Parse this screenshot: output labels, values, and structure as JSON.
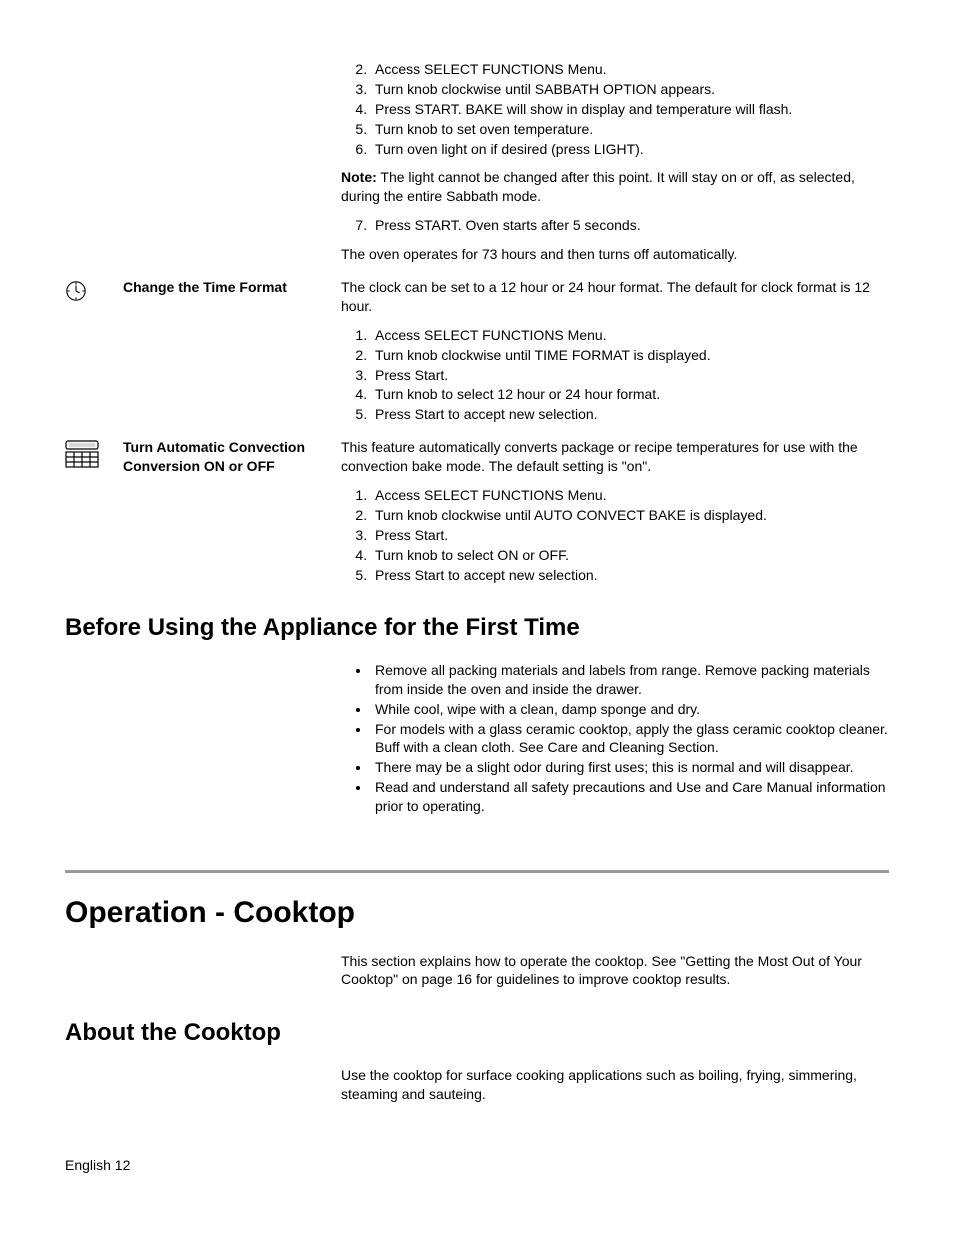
{
  "block1": {
    "step2": "Access SELECT FUNCTIONS Menu.",
    "step3": "Turn knob clockwise until SABBATH OPTION appears.",
    "step4": "Press START. BAKE will show in display and temperature will flash.",
    "step5": "Turn knob to set oven temperature.",
    "step6": "Turn oven light on if desired (press LIGHT).",
    "note_label": "Note:",
    "note_text": " The light cannot be changed after this point. It will stay on or off, as selected, during the entire Sabbath mode.",
    "step7": "Press START. Oven starts after 5 seconds.",
    "after": "The oven operates for 73 hours and then turns off automatically."
  },
  "block2": {
    "label": "Change the Time Format",
    "intro": "The clock can be set to a 12 hour or 24 hour format. The default for clock format is 12 hour.",
    "step1": "Access SELECT FUNCTIONS Menu.",
    "step2": "Turn knob clockwise until TIME FORMAT is displayed.",
    "step3": "Press Start.",
    "step4": "Turn knob to select 12 hour or 24 hour format.",
    "step5": "Press Start to accept new selection."
  },
  "block3": {
    "label": "Turn Automatic Convection Conversion ON or OFF",
    "intro": "This feature automatically converts package or recipe temperatures for use with the convection bake mode. The default setting is \"on\".",
    "step1": "Access SELECT FUNCTIONS Menu.",
    "step2": "Turn knob clockwise until AUTO CONVECT BAKE is displayed.",
    "step3": "Press Start.",
    "step4": "Turn knob to select ON or OFF.",
    "step5": "Press Start to accept new selection."
  },
  "before_heading": "Before Using the Appliance for the First Time",
  "before_bullets": {
    "b1": "Remove all packing materials and labels from range. Remove packing materials from inside the oven and inside the drawer.",
    "b2": "While cool, wipe with a clean, damp sponge and dry.",
    "b3": "For models with a glass ceramic cooktop, apply the glass ceramic cooktop cleaner. Buff with a clean cloth. See Care and Cleaning Section.",
    "b4": "There may be a slight odor during first uses; this is normal and will disappear.",
    "b5": "Read and understand all safety precautions and Use and Care Manual information prior to operating."
  },
  "operation_heading": "Operation - Cooktop",
  "operation_intro": "This section explains how to operate the cooktop. See \"Getting the Most Out of Your Cooktop\" on page 16 for guidelines to improve cooktop results.",
  "about_heading": "About the Cooktop",
  "about_text": "Use the cooktop for surface cooking applications such as boiling, frying, simmering, steaming and sauteing.",
  "footer": "English 12"
}
